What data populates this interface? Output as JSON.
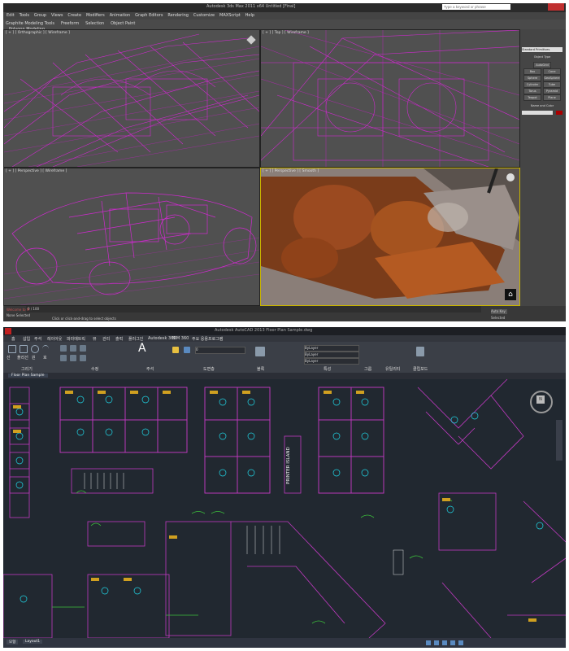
{
  "top_app": {
    "title": "Autodesk 3ds Max 2011 x64  Untitled  [Final]",
    "search_placeholder": "Type a keyword or phrase",
    "menus": [
      "Edit",
      "Tools",
      "Group",
      "Views",
      "Create",
      "Modifiers",
      "Animation",
      "Graph Editors",
      "Rendering",
      "Customize",
      "MAXScript",
      "Help"
    ],
    "ribbon_tabs": [
      "Graphite Modeling Tools",
      "Freeform",
      "Selection",
      "Object Paint"
    ],
    "ribbon_panel": "Polygon Modeling",
    "viewports": [
      {
        "label": "[ + ] [ Orthographic ] [ Wireframe ]"
      },
      {
        "label": "[ + ] [ Top ] [ Wireframe ]"
      },
      {
        "label": "[ + ] [ Perspective ] [ Wireframe ]"
      },
      {
        "label": "[ + ] [ Perspective ] [ Smooth ]"
      }
    ],
    "command_panel": {
      "dropdown": "Standard Primitives",
      "section": "Object Type",
      "autogrid": "AutoGrid",
      "buttons": [
        "Box",
        "Cone",
        "Sphere",
        "GeoSphere",
        "Cylinder",
        "Tube",
        "Torus",
        "Pyramid",
        "Teapot",
        "Plane"
      ],
      "section2": "Name and Color"
    },
    "status": {
      "left": "None Selected",
      "hint": "Click or click-and-drag to select objects",
      "welcome": "Welcome to M",
      "frame": "0 / 100",
      "key": "Auto Key",
      "sel": "Selected"
    }
  },
  "bottom_app": {
    "title": "Autodesk AutoCAD 2013  Floor Plan Sample.dwg",
    "tabs": [
      "홈",
      "삽입",
      "주석",
      "레이아웃",
      "파라메트릭",
      "뷰",
      "관리",
      "출력",
      "플러그인",
      "Autodesk 360",
      "BIM 360",
      "주요 응용프로그램"
    ],
    "panels": [
      "그리기",
      "수정",
      "주석",
      "도면층",
      "블록",
      "특성",
      "그룹",
      "유틸리티",
      "클립보드"
    ],
    "draw_tools": [
      "선",
      "폴리선",
      "원",
      "호"
    ],
    "layer_value": "0",
    "properties": [
      "ByLayer",
      "ByLayer",
      "ByLayer"
    ],
    "drawing_tab": "Floor Plan Sample",
    "label_printer": "PRINTER ISLAND",
    "layout_tabs": [
      "모형",
      "Layout1"
    ],
    "viewcube_label": "N"
  }
}
